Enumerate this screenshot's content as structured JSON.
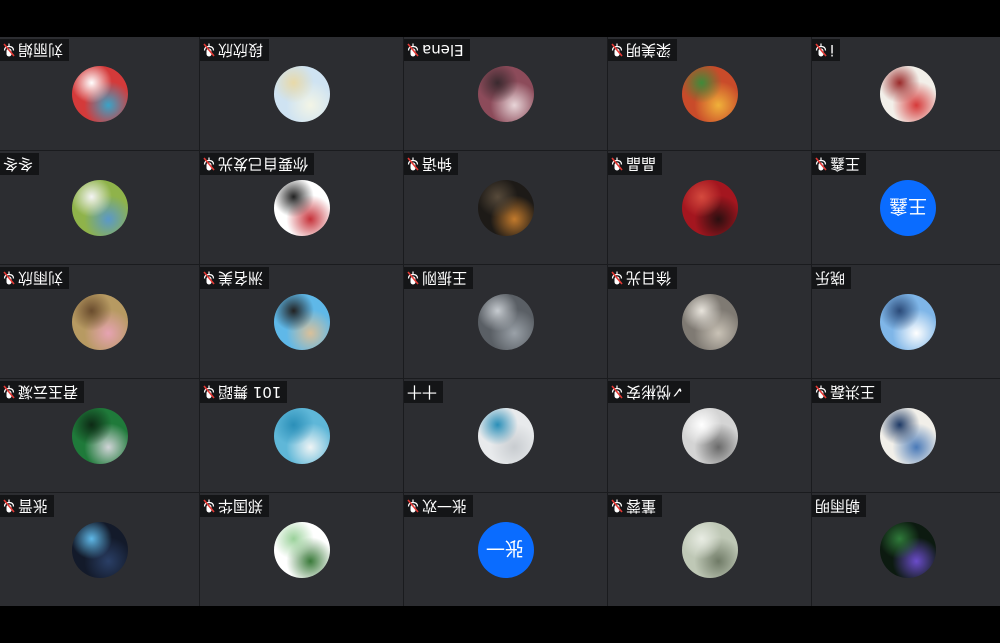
{
  "participants": [
    {
      "name": "刘丽娟",
      "muted": true,
      "avatar": {
        "type": "photo",
        "icon": "avatar-photo",
        "colors": [
          "#d43a3a",
          "#3aa3c7",
          "#ffffff"
        ]
      }
    },
    {
      "name": "段欣欣",
      "muted": true,
      "avatar": {
        "type": "photo",
        "icon": "avatar-photo",
        "colors": [
          "#cfe3f2",
          "#f3f5e6",
          "#e8d9a8"
        ]
      }
    },
    {
      "name": "Elena",
      "muted": true,
      "avatar": {
        "type": "photo",
        "icon": "avatar-photo",
        "colors": [
          "#8c4b5a",
          "#e8d5d8",
          "#3a2a2f"
        ]
      }
    },
    {
      "name": "梁美明",
      "muted": true,
      "avatar": {
        "type": "photo",
        "icon": "avatar-photo",
        "colors": [
          "#c94b2a",
          "#f0b13a",
          "#3f8a3a"
        ]
      }
    },
    {
      "name": "i",
      "muted": true,
      "avatar": {
        "type": "photo",
        "icon": "avatar-photo",
        "colors": [
          "#f2efe9",
          "#d63a3a",
          "#9a2a2a"
        ]
      }
    },
    {
      "name": "冬冬",
      "muted": false,
      "avatar": {
        "type": "photo",
        "icon": "avatar-photo",
        "colors": [
          "#8fb34a",
          "#5a98c9",
          "#f4f4f4"
        ]
      }
    },
    {
      "name": "你要自己发光",
      "muted": true,
      "avatar": {
        "type": "photo",
        "icon": "avatar-photo",
        "colors": [
          "#ffffff",
          "#c6323a",
          "#222222"
        ]
      }
    },
    {
      "name": "钟语",
      "muted": true,
      "avatar": {
        "type": "photo",
        "icon": "avatar-photo",
        "colors": [
          "#1d1a17",
          "#c27a2c",
          "#574a3a"
        ]
      }
    },
    {
      "name": "晶晶",
      "muted": true,
      "avatar": {
        "type": "photo",
        "icon": "avatar-photo",
        "colors": [
          "#a4161f",
          "#2a0f10",
          "#d44a3e"
        ]
      }
    },
    {
      "name": "王鑫",
      "muted": true,
      "avatar": {
        "type": "initials",
        "icon": "avatar-initials",
        "text": "王鑫",
        "colors": [
          "#0a6cff"
        ]
      }
    },
    {
      "name": "刘雨欣",
      "muted": true,
      "avatar": {
        "type": "photo",
        "icon": "avatar-photo",
        "colors": [
          "#b79a62",
          "#e6a3b2",
          "#6a4c2e"
        ]
      }
    },
    {
      "name": "洲名美",
      "muted": true,
      "avatar": {
        "type": "photo",
        "icon": "avatar-photo",
        "colors": [
          "#5fb8e8",
          "#d9c09a",
          "#222222"
        ]
      }
    },
    {
      "name": "王振刚",
      "muted": true,
      "avatar": {
        "type": "photo",
        "icon": "avatar-photo",
        "colors": [
          "#5a5f65",
          "#9aa1a8",
          "#c6cbd0"
        ]
      }
    },
    {
      "name": "徐日光",
      "muted": true,
      "avatar": {
        "type": "photo",
        "icon": "avatar-photo",
        "colors": [
          "#7f7a73",
          "#c9c2b6",
          "#e8e4dc"
        ]
      }
    },
    {
      "name": "晓乐",
      "muted": false,
      "avatar": {
        "type": "photo",
        "icon": "avatar-photo",
        "colors": [
          "#7fb6e8",
          "#ffffff",
          "#2b4a78"
        ]
      }
    },
    {
      "name": "君玉云凝",
      "muted": true,
      "avatar": {
        "type": "photo",
        "icon": "avatar-photo",
        "colors": [
          "#1f7a3a",
          "#d0d4d7",
          "#0d2a15"
        ]
      }
    },
    {
      "name": "101 舞蹈",
      "muted": true,
      "avatar": {
        "type": "photo",
        "icon": "avatar-photo",
        "colors": [
          "#5fb7d8",
          "#eff4f5",
          "#2b8fb8"
        ]
      }
    },
    {
      "name": "十十",
      "muted": false,
      "avatar": {
        "type": "photo",
        "icon": "avatar-photo",
        "colors": [
          "#e8eaec",
          "#c8ccd0",
          "#2a8fb8"
        ]
      }
    },
    {
      "name": "✓悦彬安",
      "muted": true,
      "avatar": {
        "type": "photo",
        "icon": "avatar-photo",
        "colors": [
          "#d4d4d4",
          "#6a6a6a",
          "#ffffff"
        ]
      }
    },
    {
      "name": "王洪磊",
      "muted": true,
      "avatar": {
        "type": "photo",
        "icon": "avatar-photo",
        "colors": [
          "#f1efe9",
          "#4a7ab8",
          "#1e3a66"
        ]
      }
    },
    {
      "name": "张晋",
      "muted": true,
      "avatar": {
        "type": "photo",
        "icon": "avatar-photo",
        "colors": [
          "#131a2a",
          "#2a3f66",
          "#5fb8e8"
        ]
      }
    },
    {
      "name": "郑国华",
      "muted": true,
      "avatar": {
        "type": "photo",
        "icon": "avatar-photo",
        "colors": [
          "#ffffff",
          "#3a7a3a",
          "#9ad19a"
        ]
      }
    },
    {
      "name": "张一欢",
      "muted": true,
      "avatar": {
        "type": "initials",
        "icon": "avatar-initials",
        "text": "张一",
        "colors": [
          "#0a6cff"
        ]
      }
    },
    {
      "name": "董蓉",
      "muted": true,
      "avatar": {
        "type": "photo",
        "icon": "avatar-photo",
        "colors": [
          "#bfc8b6",
          "#6f7a66",
          "#e8ece3"
        ]
      }
    },
    {
      "name": "朝雨明",
      "muted": false,
      "avatar": {
        "type": "photo",
        "icon": "avatar-photo",
        "colors": [
          "#0c1a10",
          "#6a4cc9",
          "#2f7a3a"
        ]
      }
    }
  ]
}
